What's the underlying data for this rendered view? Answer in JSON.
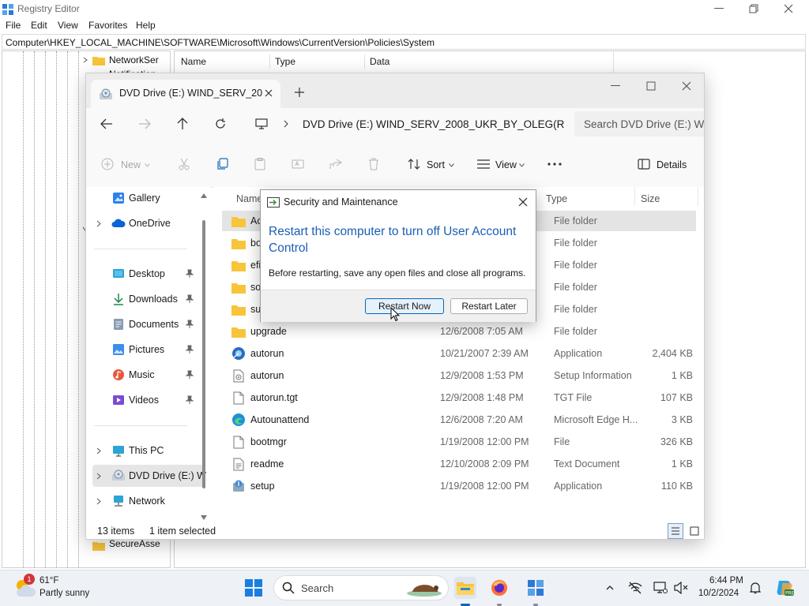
{
  "registry": {
    "title": "Registry Editor",
    "menu": [
      "File",
      "Edit",
      "View",
      "Favorites",
      "Help"
    ],
    "address": "Computer\\HKEY_LOCAL_MACHINE\\SOFTWARE\\Microsoft\\Windows\\CurrentVersion\\Policies\\System",
    "columns": [
      "Name",
      "Type",
      "Data"
    ],
    "tree_visible": [
      "NetworkSer",
      "Notification",
      "SecureAsse"
    ]
  },
  "explorer": {
    "tab_title": "DVD Drive (E:) WIND_SERV_20",
    "path": "DVD Drive (E:) WIND_SERV_2008_UKR_BY_OLEG(R",
    "search_placeholder": "Search DVD Drive (E:) WI",
    "commands": {
      "new": "New",
      "sort": "Sort",
      "view": "View",
      "details": "Details"
    },
    "nav": [
      {
        "label": "Gallery",
        "icon": "gallery-icon"
      },
      {
        "label": "OneDrive",
        "icon": "cloud-icon"
      },
      {
        "label": "Desktop",
        "icon": "desktop-icon"
      },
      {
        "label": "Downloads",
        "icon": "download-icon"
      },
      {
        "label": "Documents",
        "icon": "documents-icon"
      },
      {
        "label": "Pictures",
        "icon": "pictures-icon"
      },
      {
        "label": "Music",
        "icon": "music-icon"
      },
      {
        "label": "Videos",
        "icon": "videos-icon"
      },
      {
        "label": "This PC",
        "icon": "monitor-icon"
      },
      {
        "label": "DVD Drive (E:) W",
        "icon": "dvd-drive-icon"
      },
      {
        "label": "Network",
        "icon": "network-icon"
      }
    ],
    "columns": {
      "name": "Name",
      "type": "Type",
      "size": "Size"
    },
    "files": [
      {
        "name": "Acti",
        "date": "",
        "type": "File folder",
        "size": ""
      },
      {
        "name": "boot",
        "date": "",
        "type": "File folder",
        "size": ""
      },
      {
        "name": "efi",
        "date": "",
        "type": "File folder",
        "size": ""
      },
      {
        "name": "sour",
        "date": "",
        "type": "File folder",
        "size": ""
      },
      {
        "name": "supp",
        "date": "",
        "type": "File folder",
        "size": ""
      },
      {
        "name": "upgrade",
        "date": "12/6/2008 7:05 AM",
        "type": "File folder",
        "size": ""
      },
      {
        "name": "autorun",
        "date": "10/21/2007 2:39 AM",
        "type": "Application",
        "size": "2,404 KB"
      },
      {
        "name": "autorun",
        "date": "12/9/2008 1:53 PM",
        "type": "Setup Information",
        "size": "1 KB"
      },
      {
        "name": "autorun.tgt",
        "date": "12/9/2008 1:48 PM",
        "type": "TGT File",
        "size": "107 KB"
      },
      {
        "name": "Autounattend",
        "date": "12/6/2008 7:20 AM",
        "type": "Microsoft Edge H...",
        "size": "3 KB"
      },
      {
        "name": "bootmgr",
        "date": "1/19/2008 12:00 PM",
        "type": "File",
        "size": "326 KB"
      },
      {
        "name": "readme",
        "date": "12/10/2008 2:09 PM",
        "type": "Text Document",
        "size": "1 KB"
      },
      {
        "name": "setup",
        "date": "1/19/2008 12:00 PM",
        "type": "Application",
        "size": "110 KB"
      }
    ],
    "status": {
      "items": "13 items",
      "selected": "1 item selected"
    }
  },
  "dialog": {
    "title": "Security and Maintenance",
    "heading": "Restart this computer to turn off User Account Control",
    "message": "Before restarting, save any open files and close all programs.",
    "restart_now": "Restart Now",
    "restart_later": "Restart Later"
  },
  "taskbar": {
    "weather_temp": "61°F",
    "weather_condition": "Partly sunny",
    "weather_badge": "1",
    "search_placeholder": "Search",
    "time": "6:44 PM",
    "date": "10/2/2024"
  },
  "colors": {
    "accent": "#0067c0",
    "dialog_heading": "#1a5fb4",
    "folder": "#f8c43a"
  }
}
